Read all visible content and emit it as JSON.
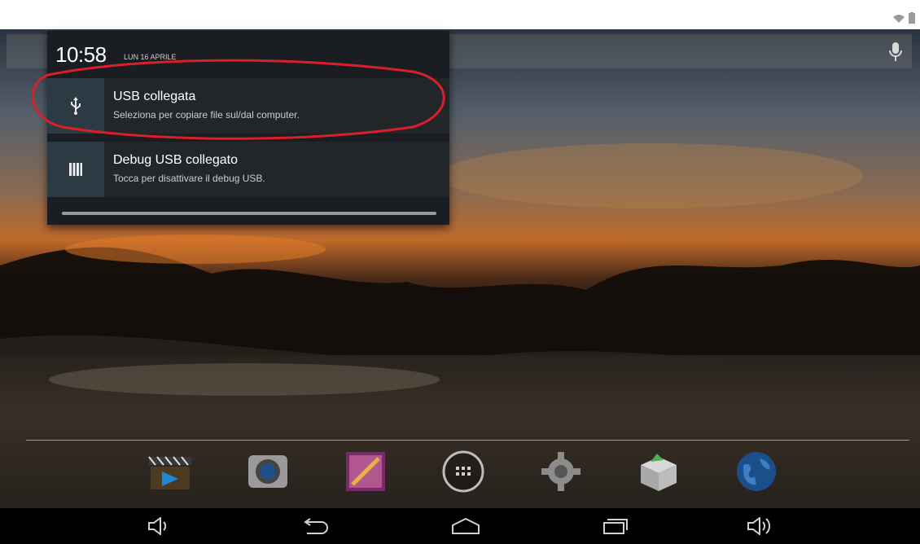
{
  "notification_shade": {
    "time": "10:58",
    "date": "LUN 16 APRILE",
    "notifications": [
      {
        "title": "USB collegata",
        "subtitle": "Seleziona per copiare file sul/dal computer.",
        "icon": "usb-icon"
      },
      {
        "title": "Debug USB collegato",
        "subtitle": "Tocca per disattivare il debug USB.",
        "icon": "debug-icon"
      }
    ]
  },
  "status_icons": [
    "wifi-icon",
    "battery-icon"
  ],
  "dock": {
    "apps": [
      "video-player-icon",
      "camera-icon",
      "gallery-icon",
      "app-drawer-icon",
      "settings-icon",
      "app-installer-icon",
      "browser-icon"
    ]
  },
  "navigation_bar": [
    "volume-down-icon",
    "back-icon",
    "home-icon",
    "recent-apps-icon",
    "volume-up-icon"
  ],
  "colors": {
    "highlight": "#d9202a",
    "shade_background": "#1a1d21",
    "notification_background": "#222629",
    "icon_tile": "#2c3a44",
    "navbar": "#000000"
  }
}
